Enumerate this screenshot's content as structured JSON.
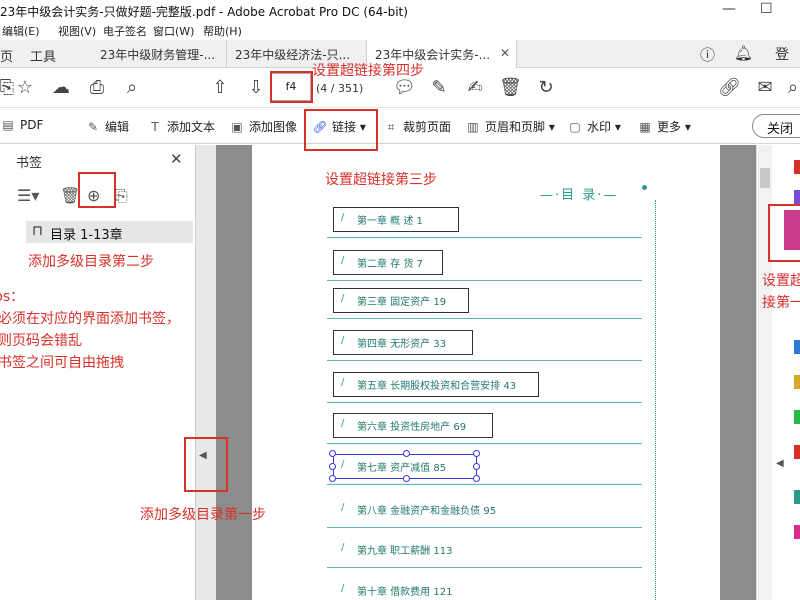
{
  "window": {
    "title": "23年中级会计实务-只做好题-完整版.pdf - Adobe Acrobat Pro DC (64-bit)"
  },
  "menu": [
    "编辑(E)",
    "视图(V)",
    "电子签名",
    "窗口(W)",
    "帮助(H)"
  ],
  "nav": {
    "home": "页",
    "tools": "工具"
  },
  "tabs": [
    {
      "label": "23年中级财务管理-..."
    },
    {
      "label": "23年中级经济法-只..."
    },
    {
      "label": "23年中级会计实务-...",
      "active": true
    }
  ],
  "pager": {
    "current": "f4",
    "count": "(4 / 351)"
  },
  "tools": {
    "pdf": "PDF",
    "edit": "编辑",
    "add_text": "添加文本",
    "add_image": "添加图像",
    "link": "链接",
    "crop": "裁剪页面",
    "header_footer": "页眉和页脚",
    "watermark": "水印",
    "more": "更多",
    "close": "关闭"
  },
  "bookmarks": {
    "title": "书签",
    "items": [
      {
        "label": "目录 1-13章"
      }
    ]
  },
  "toc": {
    "title": "—·目  录·—",
    "entries": [
      {
        "text": "第一章   概   述    1"
      },
      {
        "text": "第二章   存   货    7"
      },
      {
        "text": "第三章   固定资产    19"
      },
      {
        "text": "第四章   无形资产    33"
      },
      {
        "text": "第五章   长期股权投资和合营安排    43"
      },
      {
        "text": "第六章   投资性房地产    69"
      },
      {
        "text": "第七章   资产减值    85"
      },
      {
        "text": "第八章   金融资产和金融负债    95"
      },
      {
        "text": "第九章   职工薪酬    113"
      },
      {
        "text": "第十章   借款费用    121"
      }
    ]
  },
  "annotations": {
    "link_step4": "设置超链接第四步",
    "link_step3": "设置超链接第三步",
    "link_step_right_1": "设置超",
    "link_step_right_2": "接第一",
    "bm_step2": "添加多级目录第二步",
    "bm_step1": "添加多级目录第一步",
    "tips_title": "ps：",
    "tips_1": "必须在对应的界面添加书签，",
    "tips_2": "则页码会错乱",
    "tips_3": "书签之间可自由拖拽"
  },
  "colors": {
    "annotation": "#d8312a",
    "toc": "#2a9a8c",
    "link_icon": "#c83a8a"
  }
}
